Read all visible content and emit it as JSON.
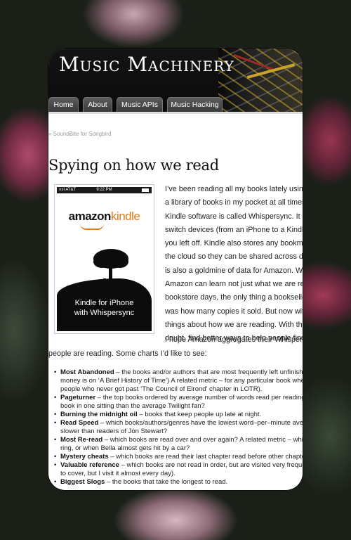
{
  "site": {
    "title": "Music Machinery",
    "nav": [
      {
        "label": "Home"
      },
      {
        "label": "About"
      },
      {
        "label": "Music APIs"
      },
      {
        "label": "Music Hacking"
      }
    ]
  },
  "breadcrumb": "« SoundBite for Songbird",
  "post": {
    "title": "Spying on how we read",
    "image": {
      "status_carrier": "ııııl AT&T",
      "status_time": "9:22 PM",
      "brand_amazon": "amazon",
      "brand_kindle": "kindle",
      "caption_line1": "Kindle for iPhone",
      "caption_line2": "with Whispersync"
    },
    "para1_lines": [
      "I’ve been reading all my books lately using K",
      "a library of books in my pocket at all times r",
      "Kindle software is called Whispersync.  It kee",
      "switch devices (from an iPhone to a Kindle o",
      "you left off.  Kindle also stores any bookmar",
      "the cloud so they can be shared across devic",
      "is also a goldmine of data for Amazon.  With",
      "Amazon can learn not just what we are read",
      "bookstore days, the only thing a bookseller,",
      "was how many copies it sold.  But now with",
      "things about how we are reading.  With the i",
      "doubt,  find better ways to help people find"
    ],
    "para2_line1": "I hope Amazon aggregates their Whispersyn",
    "para2_line2": "people are reading.  Some charts I’d like to see:",
    "list": [
      {
        "term": "Most Abandoned",
        "lines": [
          " – the books and/or authors that are most frequently left unfinishe",
          "money is on ‘A Brief History of Time’) A related metric – for any particular book whe",
          "people who never got past ‘The Council of Elrond’ chapter in LOTR)."
        ]
      },
      {
        "term": "Pageturner",
        "lines": [
          " – the top books ordered by average number of words read per reading s",
          "book in one sitting than the average Twilight fan?"
        ]
      },
      {
        "term": "Burning the midnight oil",
        "lines": [
          " – books that keep people up late at night."
        ]
      },
      {
        "term": "Read Speed",
        "lines": [
          " – which books/authors/genres have the lowest word–per–minute averag",
          "slower than readers of Jon Stewart?"
        ]
      },
      {
        "term": "Most Re-read",
        "lines": [
          " – which books are read over and over again?  A related metric – which",
          "ring,  or when Bella almost gets hit by a car?"
        ]
      },
      {
        "term": "Mystery cheats",
        "lines": [
          " – which books are read their last chapter read before other chapters."
        ]
      },
      {
        "term": "Valuable reference",
        "lines": [
          " – which books are not read in order, but are visited very frequen",
          "to cover, but I visit it almost every day)."
        ]
      },
      {
        "term": "Biggest Slogs",
        "lines": [
          " – the books that take the longest to read."
        ]
      }
    ]
  }
}
